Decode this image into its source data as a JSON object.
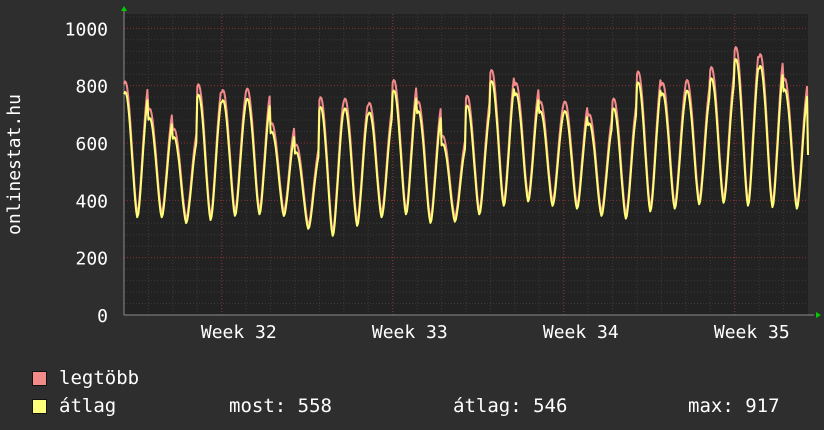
{
  "chart_data": {
    "type": "line",
    "ylabel": "onlinestat.hu",
    "ylim": [
      0,
      1050
    ],
    "yticks": [
      0,
      200,
      400,
      600,
      800,
      1000
    ],
    "x_tick_labels": [
      "Week 32",
      "Week 33",
      "Week 34",
      "Week 35"
    ],
    "grid": true,
    "legend_position": "bottom-left",
    "daily_peaks_max": [
      815,
      720,
      650,
      805,
      785,
      790,
      670,
      595,
      760,
      755,
      740,
      820,
      745,
      625,
      765,
      855,
      810,
      745,
      745,
      700,
      755,
      850,
      810,
      820,
      865,
      935,
      910,
      825
    ],
    "daily_troughs": [
      340,
      340,
      320,
      330,
      345,
      350,
      345,
      300,
      275,
      310,
      340,
      350,
      320,
      325,
      350,
      380,
      395,
      380,
      370,
      345,
      335,
      360,
      370,
      385,
      390,
      380,
      375,
      370
    ],
    "last_value": 558,
    "series": [
      {
        "name": "legtöbb",
        "color": "#f28a8a"
      },
      {
        "name": "átlag",
        "color": "#ffff7a"
      }
    ]
  },
  "legend": {
    "items": [
      {
        "label": "legtöbb",
        "color": "#f28a8a"
      },
      {
        "label": "átlag",
        "color": "#ffff7a"
      }
    ],
    "stats": {
      "most": "most: 558",
      "atlag": "átlag: 546",
      "max": "max: 917"
    }
  },
  "colors": {
    "background": "#2e2e2e",
    "plot_background": "#222222",
    "grid_minor": "#3a3a3a",
    "grid_major": "#8a3030",
    "axis": "#8a8a8a",
    "arrow": "#00cc00"
  }
}
